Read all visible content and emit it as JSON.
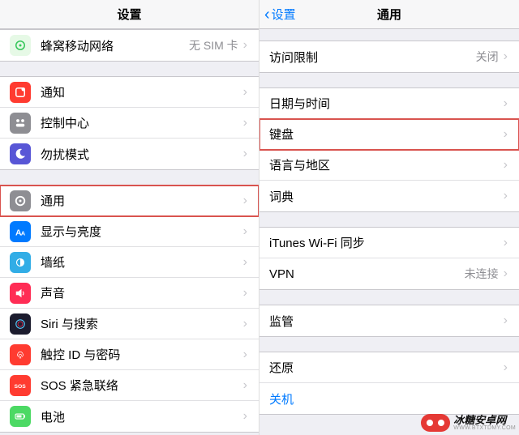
{
  "left": {
    "title": "设置",
    "cellular": {
      "label": "蜂窝移动网络",
      "value": "无 SIM 卡"
    },
    "group2": {
      "notifications": "通知",
      "controlCenter": "控制中心",
      "dnd": "勿扰模式"
    },
    "group3": {
      "general": "通用",
      "display": "显示与亮度",
      "wallpaper": "墙纸",
      "sound": "声音",
      "siri": "Siri 与搜索",
      "touchid": "触控 ID 与密码",
      "sos": "SOS 紧急联络",
      "battery": "电池"
    }
  },
  "right": {
    "back": "设置",
    "title": "通用",
    "restrictions": {
      "label": "访问限制",
      "value": "关闭"
    },
    "group2": {
      "datetime": "日期与时间",
      "keyboard": "键盘",
      "language": "语言与地区",
      "dictionary": "词典"
    },
    "group3": {
      "itunes": "iTunes Wi-Fi 同步",
      "vpn": {
        "label": "VPN",
        "value": "未连接"
      }
    },
    "profiles": "监管",
    "reset": "还原",
    "shutdown": "关机"
  },
  "watermark": {
    "line1": "冰糖安卓网",
    "line2": "WWW.BTXTDMY.COM"
  }
}
